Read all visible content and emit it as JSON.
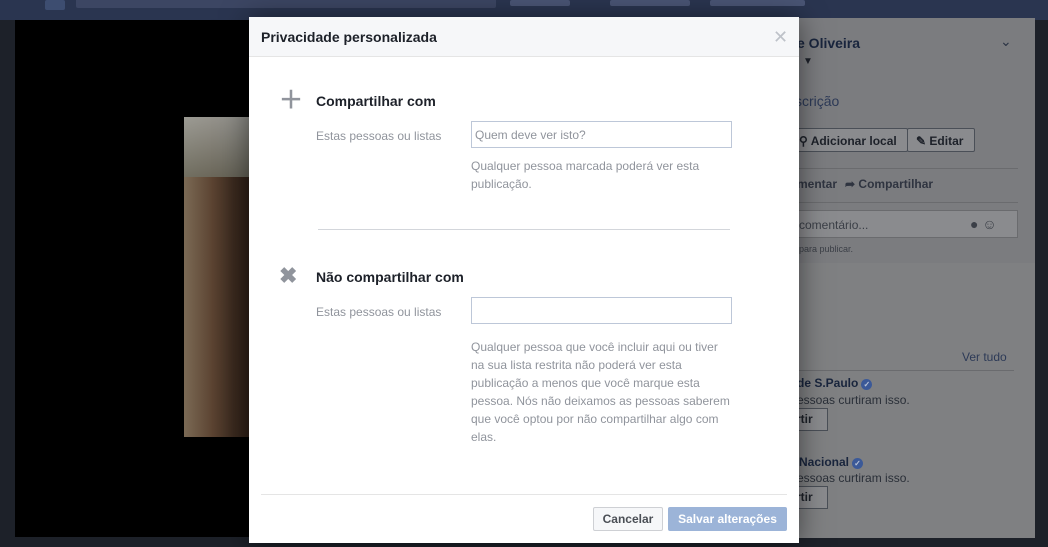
{
  "background": {
    "profile_name_fragment": "e Oliveira",
    "chevron_icon": "chevron-down-icon",
    "description_fragment": "scrição",
    "add_location": "Adicionar local",
    "edit": "Editar",
    "comment_fragment": "mentar",
    "share": "Compartilhar",
    "comment_placeholder_fragment": "comentário...",
    "publish_hint_fragment": "para publicar.",
    "see_all": "Ver tudo",
    "page1_name_fragment": "de S.Paulo",
    "page1_likes_fragment": "essoas curtiram isso.",
    "page2_name_fragment": "Nacional",
    "page2_likes_fragment": "essoas curtiram isso.",
    "like_button_fragment": "rtir"
  },
  "modal": {
    "title": "Privacidade personalizada",
    "share_with": {
      "title": "Compartilhar com",
      "label": "Estas pessoas ou listas",
      "placeholder": "Quem deve ver isto?",
      "value": "",
      "help": "Qualquer pessoa marcada poderá ver esta publicação."
    },
    "dont_share_with": {
      "title": "Não compartilhar com",
      "label": "Estas pessoas ou listas",
      "placeholder": "",
      "value": "",
      "help": "Qualquer pessoa que você incluir aqui ou tiver na sua lista restrita não poderá ver esta publicação a menos que você marque esta pessoa. Nós não deixamos as pessoas saberem que você optou por não compartilhar algo com elas."
    },
    "cancel_label": "Cancelar",
    "save_label": "Salvar alterações"
  },
  "colors": {
    "save_button": "#9cb4d8",
    "header_bg": "#f6f7f9",
    "muted_text": "#90949c"
  }
}
